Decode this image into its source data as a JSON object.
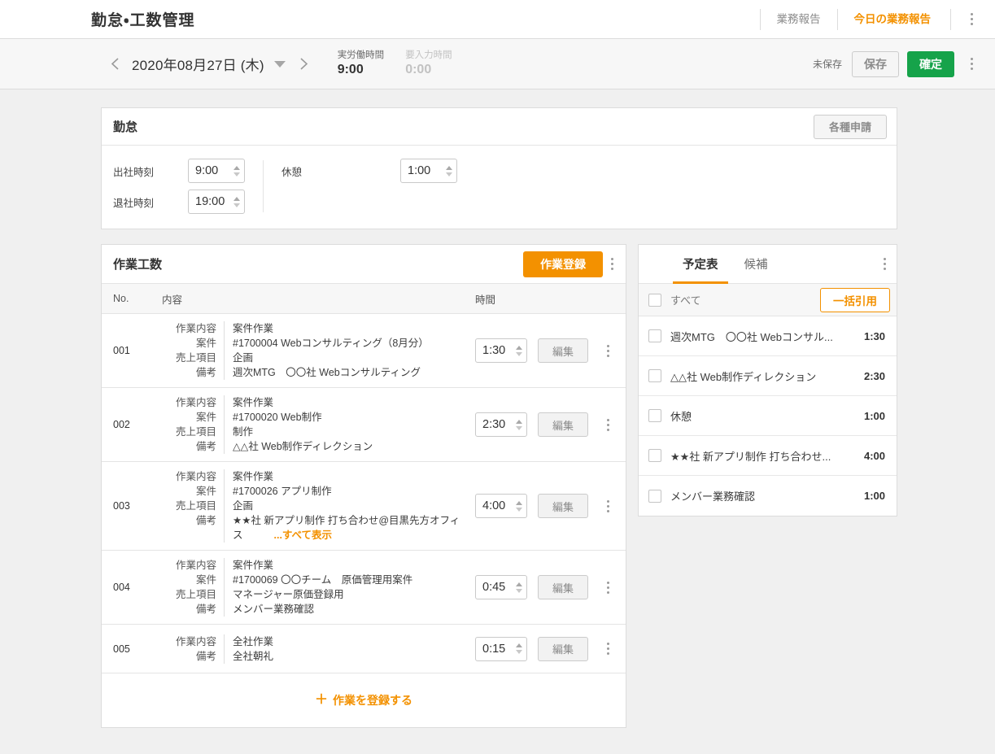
{
  "header": {
    "app_title": "勤怠・工数管理",
    "nav": [
      {
        "label": "業務報告",
        "active": false
      },
      {
        "label": "今日の業務報告",
        "active": true
      }
    ],
    "menu_icon": "kebab-menu-icon"
  },
  "datebar": {
    "prev_icon": "chevron-left-icon",
    "next_icon": "chevron-right-icon",
    "dropdown_icon": "caret-down-icon",
    "date": "2020年08月27日 (木)",
    "date_year_month_day": "2020年08月27日",
    "date_dow": "(木)",
    "metrics": [
      {
        "label": "実労働時間",
        "value": "9:00",
        "muted": false
      },
      {
        "label": "要入力時間",
        "value": "0:00",
        "muted": true
      }
    ],
    "unsaved_status": "未保存",
    "save_label": "保存",
    "confirm_label": "確定",
    "confirm_color": "#16a34a",
    "menu_icon": "kebab-menu-icon"
  },
  "attendance": {
    "title": "勤怠",
    "apply_label": "各種申請",
    "clock_in_label": "出社時刻",
    "clock_in_value": "9:00",
    "clock_out_label": "退社時刻",
    "clock_out_value": "19:00",
    "break_label": "休憩",
    "break_value": "1:00"
  },
  "worklog": {
    "title": "作業工数",
    "register_label": "作業登録",
    "menu_icon": "kebab-menu-icon",
    "columns": {
      "no": "No.",
      "content": "内容",
      "time": "時間"
    },
    "labels": {
      "task": "作業内容",
      "project": "案件",
      "sales_item": "売上項目",
      "note": "備考",
      "edit": "編集",
      "show_all": "...すべて表示"
    },
    "rows": [
      {
        "no": "001",
        "task": "案件作業",
        "project": "#1700004 Webコンサルティング（8月分）",
        "sales_item": "企画",
        "note": "週次MTG　〇〇社 Webコンサルティング",
        "note_truncated": false,
        "time": "1:30"
      },
      {
        "no": "002",
        "task": "案件作業",
        "project": "#1700020 Web制作",
        "sales_item": "制作",
        "note": "△△社 Web制作ディレクション",
        "note_truncated": false,
        "time": "2:30"
      },
      {
        "no": "003",
        "task": "案件作業",
        "project": "#1700026 アプリ制作",
        "sales_item": "企画",
        "note": "★★社 新アプリ制作 打ち合わせ@目黒先方オフィス",
        "note_truncated": true,
        "time": "4:00"
      },
      {
        "no": "004",
        "task": "案件作業",
        "project": "#1700069 〇〇チーム　原価管理用案件",
        "sales_item": "マネージャー原価登録用",
        "note": "メンバー業務確認",
        "note_truncated": false,
        "time": "0:45"
      },
      {
        "no": "005",
        "task": "全社作業",
        "project": null,
        "sales_item": null,
        "note": "全社朝礼",
        "note_truncated": false,
        "time": "0:15"
      }
    ],
    "add_label": "作業を登録する",
    "add_icon": "plus-icon"
  },
  "schedule": {
    "tabs": [
      {
        "label": "予定表",
        "active": true
      },
      {
        "label": "候補",
        "active": false
      }
    ],
    "menu_icon": "kebab-menu-icon",
    "select_all_label": "すべて",
    "bulk_quote_label": "一括引用",
    "items": [
      {
        "text": "週次MTG　〇〇社 Webコンサル...",
        "time": "1:30",
        "checked": false
      },
      {
        "text": "△△社 Web制作ディレクション",
        "time": "2:30",
        "checked": false
      },
      {
        "text": "休憩",
        "time": "1:00",
        "checked": false
      },
      {
        "text": "★★社 新アプリ制作 打ち合わせ...",
        "time": "4:00",
        "checked": false
      },
      {
        "text": "メンバー業務確認",
        "time": "1:00",
        "checked": false
      }
    ]
  },
  "colors": {
    "accent_orange": "#f39100",
    "confirm_green": "#16a34a",
    "page_bg": "#f0f0f0",
    "card_bg": "#ffffff",
    "border": "#dcdcdc"
  }
}
